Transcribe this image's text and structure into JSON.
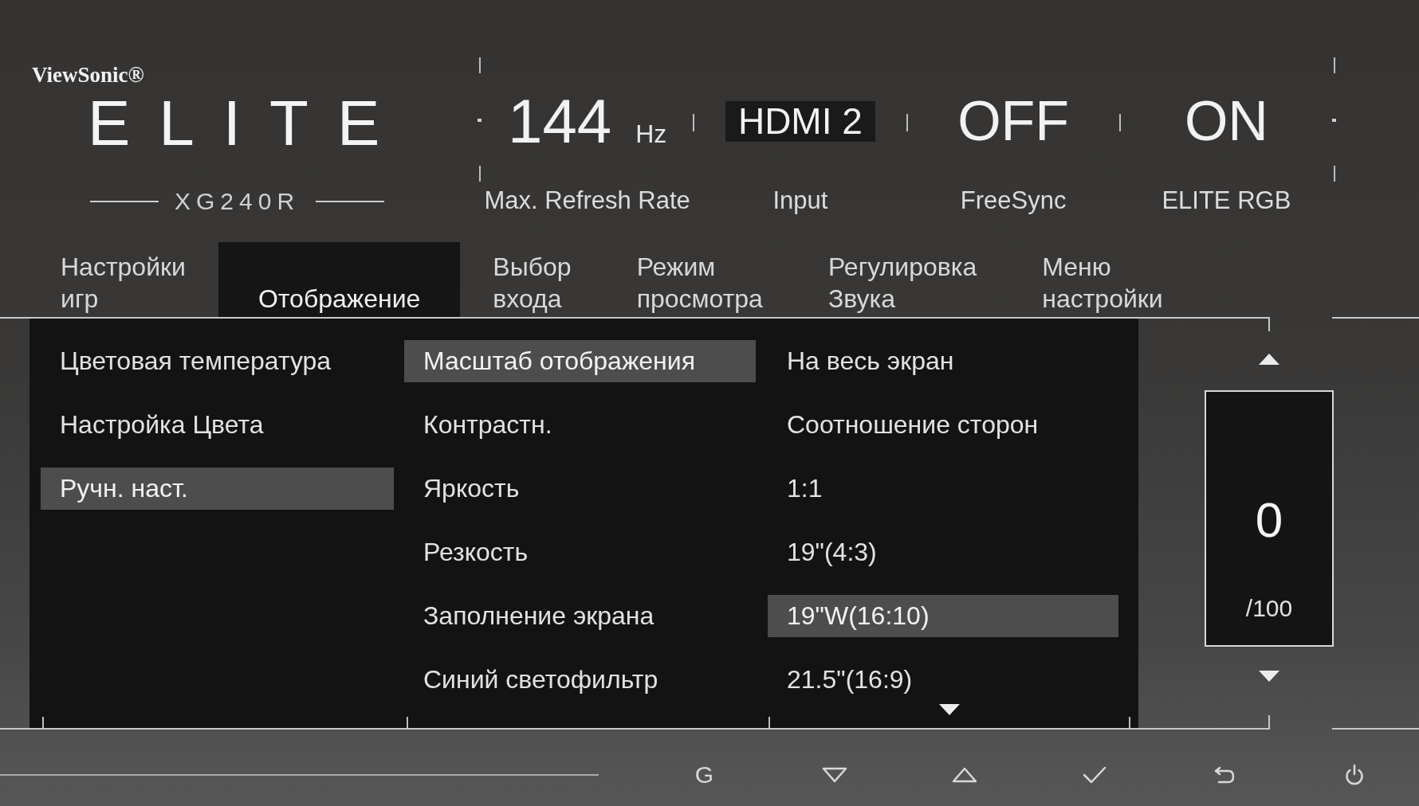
{
  "brand": {
    "maker": "ViewSonic®",
    "logo": "ELITE",
    "model": "XG240R"
  },
  "status": [
    {
      "kind": "number",
      "value": "144",
      "unit": "Hz",
      "label": "Max. Refresh Rate"
    },
    {
      "kind": "badge",
      "value": "HDMI 2",
      "label": "Input"
    },
    {
      "kind": "plain",
      "value": "OFF",
      "label": "FreeSync"
    },
    {
      "kind": "plain",
      "value": "ON",
      "label": "ELITE RGB"
    }
  ],
  "tabs": [
    {
      "label": "Настройки игр",
      "selected": false
    },
    {
      "label": "Отображение",
      "selected": true
    },
    {
      "label": "Выбор входа",
      "selected": false
    },
    {
      "label": "Режим просмотра",
      "selected": false
    },
    {
      "label": "Регулировка Звука",
      "selected": false
    },
    {
      "label": "Меню настройки",
      "selected": false
    }
  ],
  "menu_columns": [
    {
      "items": [
        {
          "label": "Цветовая температура",
          "selected": false
        },
        {
          "label": "Настройка Цвета",
          "selected": false
        },
        {
          "label": "Ручн. наст.",
          "selected": true
        }
      ]
    },
    {
      "items": [
        {
          "label": "Масштаб отображения",
          "selected": true
        },
        {
          "label": "Контрастн.",
          "selected": false
        },
        {
          "label": "Яркость",
          "selected": false
        },
        {
          "label": "Резкость",
          "selected": false
        },
        {
          "label": "Заполнение экрана",
          "selected": false
        },
        {
          "label": "Синий светофильтр",
          "selected": false
        }
      ]
    },
    {
      "items": [
        {
          "label": "На весь экран",
          "selected": false
        },
        {
          "label": "Соотношение сторон",
          "selected": false
        },
        {
          "label": "1:1",
          "selected": false
        },
        {
          "label": "19\"(4:3)",
          "selected": false
        },
        {
          "label": "19\"W(16:10)",
          "selected": true
        },
        {
          "label": "21.5\"(16:9)",
          "selected": false
        }
      ],
      "more_below": true
    }
  ],
  "value_box": {
    "value": "0",
    "scale": "/100"
  },
  "hotkeys": {
    "game_key": "G"
  }
}
